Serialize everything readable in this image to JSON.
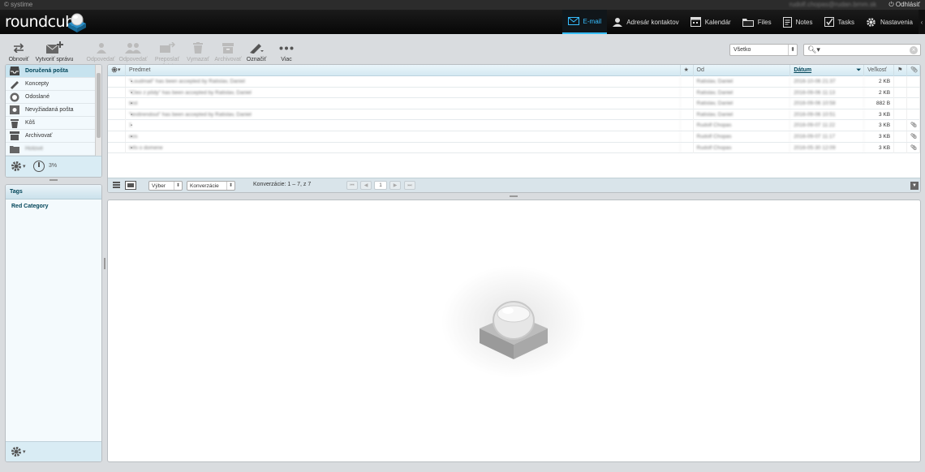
{
  "topline": {
    "about": "© systime",
    "user": "rudolf.chopas@rudan.brnm.sk",
    "logout": "Odhlásiť"
  },
  "app": {
    "logo": "roundcube"
  },
  "taskbar": [
    {
      "label": "E-mail",
      "icon": "mail-icon",
      "selected": true
    },
    {
      "label": "Adresár kontaktov",
      "icon": "contacts-icon"
    },
    {
      "label": "Kalendár",
      "icon": "calendar-icon"
    },
    {
      "label": "Files",
      "icon": "folder-icon"
    },
    {
      "label": "Notes",
      "icon": "notes-icon"
    },
    {
      "label": "Tasks",
      "icon": "tasks-icon"
    },
    {
      "label": "Nastavenia",
      "icon": "gear-icon"
    }
  ],
  "toolbar": {
    "refresh": "Obnoviť",
    "compose": "Vytvoriť správu",
    "reply": "Odpovedať",
    "reply_all": "Odpovedať",
    "forward": "Preposlať ďalej",
    "delete": "Vymazať",
    "archive": "Archivovať",
    "mark": "Označiť",
    "more": "Viac"
  },
  "search": {
    "filter": "Všetko"
  },
  "folders": [
    {
      "label": "Doručená pošta",
      "icon": "inbox-icon",
      "selected": true
    },
    {
      "label": "Koncepty",
      "icon": "drafts-icon"
    },
    {
      "label": "Odoslané",
      "icon": "sent-icon"
    },
    {
      "label": "Nevyžiadaná pošta",
      "icon": "junk-icon"
    },
    {
      "label": "Kôš",
      "icon": "trash-icon"
    },
    {
      "label": "Archivovať",
      "icon": "archive-icon"
    },
    {
      "label": "Hotové",
      "icon": "folder-icon",
      "blurred": true
    }
  ],
  "quota": {
    "text": "3%"
  },
  "tags": {
    "header": "Tags",
    "items": [
      "Red Category"
    ]
  },
  "messagelist": {
    "columns": {
      "subject": "Predmet",
      "from": "Od",
      "date": "Dátum",
      "size": "Veľkosť"
    },
    "rows": [
      {
        "subject": "\"Loudmail\" has been accepted by Ratislav, Daniel",
        "from": "Ratislav, Daniel",
        "date": "2016-10-06 21:37",
        "size": "2 KB",
        "att": false
      },
      {
        "subject": "\"Cleo z pôdy\" has been accepted by Ratislav, Daniel",
        "from": "Ratislav, Daniel",
        "date": "2016-09-06 11:13",
        "size": "2 KB",
        "att": false
      },
      {
        "subject": "test",
        "from": "Ratislav, Daniel",
        "date": "2016-09-06 10:58",
        "size": "882 B",
        "att": false
      },
      {
        "subject": "\"testtrendout\" has been accepted by Ratislav, Daniel",
        "from": "Ratislav, Daniel",
        "date": "2016-09-06 10:51",
        "size": "3 KB",
        "att": false
      },
      {
        "subject": "1",
        "from": "Rudolf Chopas",
        "date": "2016-09-07 11:22",
        "size": "3 KB",
        "att": true
      },
      {
        "subject": "eos",
        "from": "Rudolf Chopas",
        "date": "2016-09-07 11:17",
        "size": "3 KB",
        "att": true
      },
      {
        "subject": "Info o domene",
        "from": "Rudolf Chopas",
        "date": "2016-05-30 12:09",
        "size": "3 KB",
        "att": true
      }
    ],
    "footer": {
      "select": "Výber",
      "threads": "Konverzácie",
      "count": "Konverzácie: 1 – 7, z 7",
      "page": "1"
    }
  },
  "colors": {
    "accent": "#37beff",
    "selected_folder": "#c7e3ef",
    "header_bg": "#111111"
  }
}
